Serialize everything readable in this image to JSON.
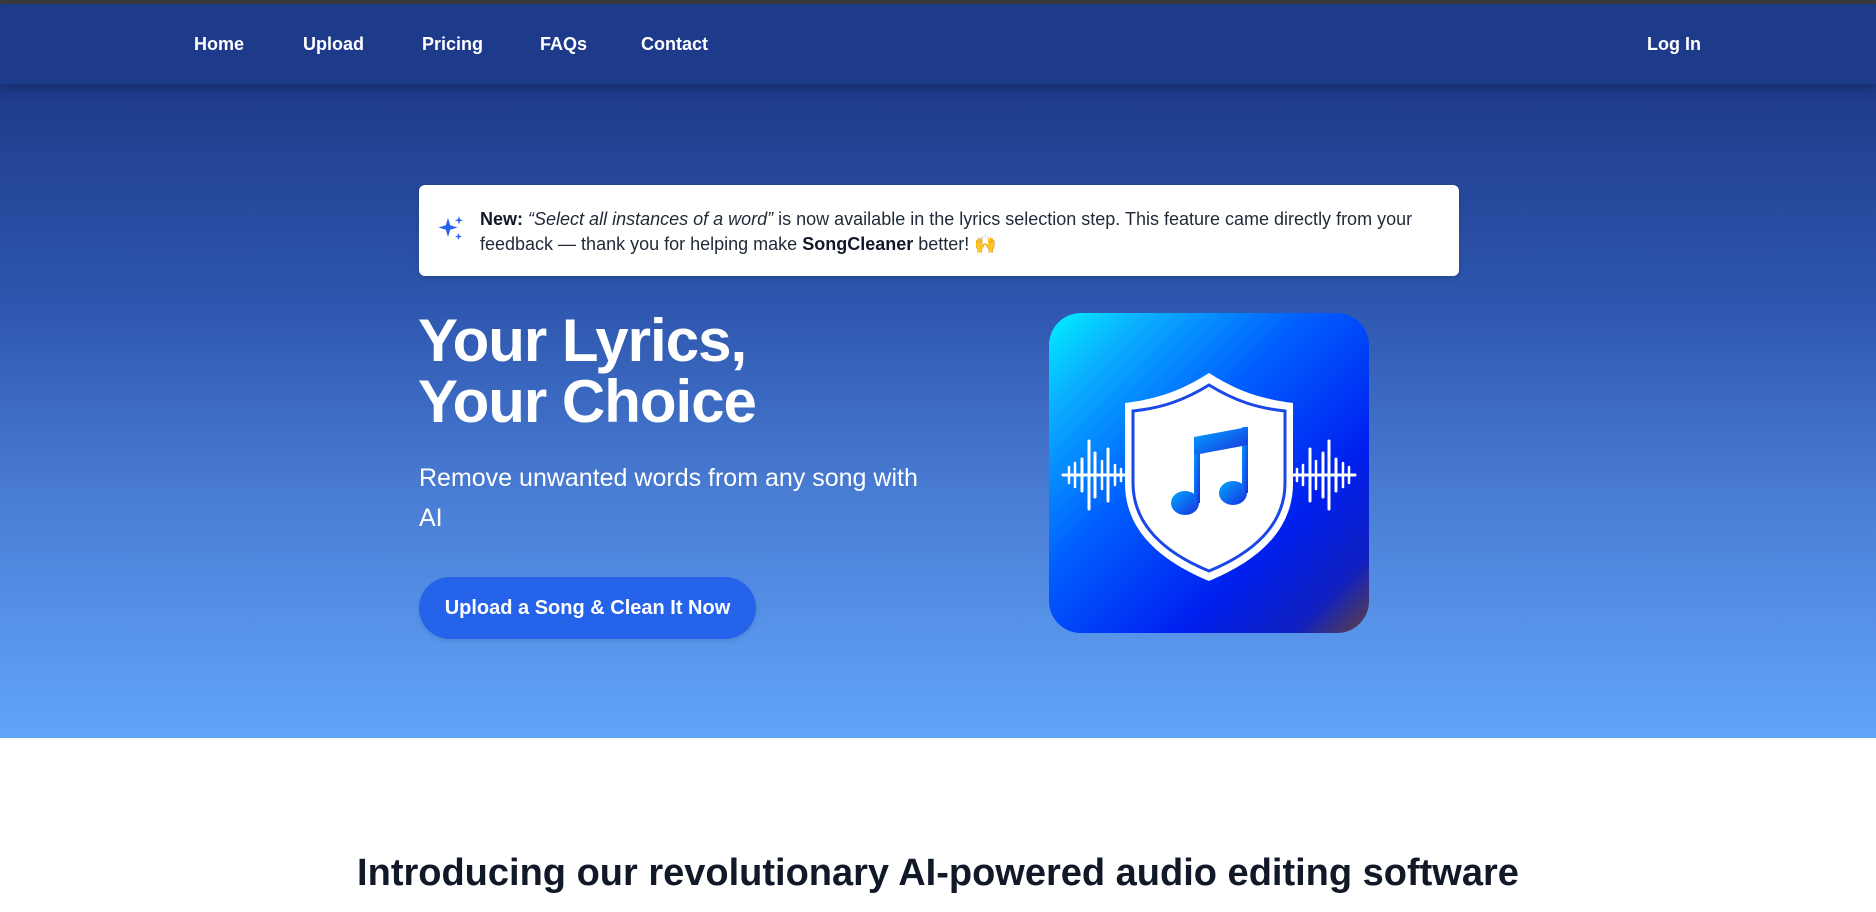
{
  "nav": {
    "items": [
      {
        "label": "Home"
      },
      {
        "label": "Upload"
      },
      {
        "label": "Pricing"
      },
      {
        "label": "FAQs"
      },
      {
        "label": "Contact"
      }
    ],
    "login_label": "Log In"
  },
  "announcement": {
    "prefix": "New:",
    "feature": "“Select all instances of a word”",
    "text_1": " is now available in the lyrics selection step. This feature came directly from your feedback — thank you for helping make ",
    "brand": "SongCleaner",
    "text_2": " better! 🙌",
    "icon": "sparkle-icon"
  },
  "hero": {
    "title_line_1": "Your Lyrics,",
    "title_line_2": "Your Choice",
    "subtitle": "Remove unwanted words from any song with AI",
    "cta_label": "Upload a Song & Clean It Now",
    "logo_icon": "shield-music-note-icon"
  },
  "intro": {
    "heading": "Introducing our revolutionary AI-powered audio editing software"
  },
  "colors": {
    "nav_bg": "#1e3a8a",
    "hero_top": "#1e3a8a",
    "hero_bottom": "#60a5fa",
    "cta_bg": "#2563eb",
    "heading_text": "#111827"
  }
}
